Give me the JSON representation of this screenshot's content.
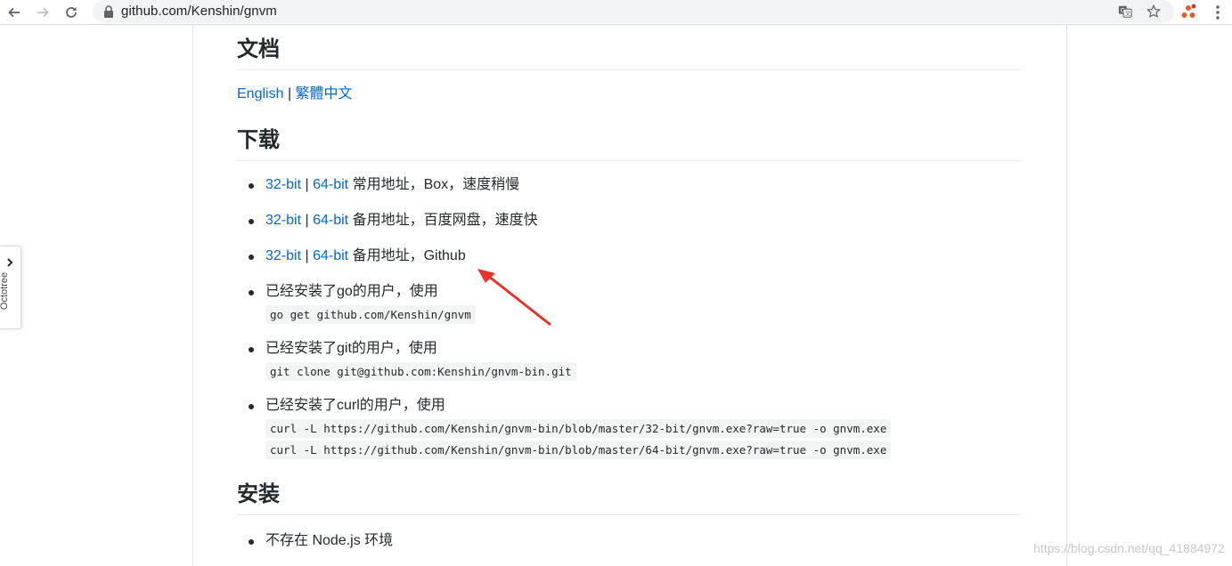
{
  "browser": {
    "url": "github.com/Kenshin/gnvm",
    "icons": [
      "back-icon",
      "forward-icon",
      "reload-icon",
      "lock-icon",
      "translate-icon",
      "bookmark-star-icon",
      "extension-icon",
      "menu-icon"
    ]
  },
  "octotree": {
    "label": "Octotree"
  },
  "sections": {
    "docs": {
      "title": "文档",
      "english": "English",
      "sep": "|",
      "traditional": "繁體中文"
    },
    "download": {
      "title": "下载",
      "items": [
        {
          "l32": "32-bit",
          "sep": "|",
          "l64": "64-bit",
          "desc": "常用地址，Box，速度稍慢"
        },
        {
          "l32": "32-bit",
          "sep": "|",
          "l64": "64-bit",
          "desc": "备用地址，百度网盘，速度快"
        },
        {
          "l32": "32-bit",
          "sep": "|",
          "l64": "64-bit",
          "desc": "备用地址，Github"
        },
        {
          "text": "已经安装了go的用户，使用",
          "code": [
            "go get github.com/Kenshin/gnvm"
          ]
        },
        {
          "text": "已经安装了git的用户，使用",
          "code": [
            "git clone git@github.com:Kenshin/gnvm-bin.git"
          ]
        },
        {
          "text": "已经安装了curl的用户，使用",
          "code": [
            "curl -L https://github.com/Kenshin/gnvm-bin/blob/master/32-bit/gnvm.exe?raw=true -o gnvm.exe",
            "curl -L https://github.com/Kenshin/gnvm-bin/blob/master/64-bit/gnvm.exe?raw=true -o gnvm.exe"
          ]
        }
      ]
    },
    "install": {
      "title": "安装",
      "items": [
        "不存在 Node.js 环境"
      ]
    }
  },
  "annotation": {
    "color": "#e8332a"
  },
  "watermark": "https://blog.csdn.net/qq_41884972",
  "colors": {
    "link": "#0366d6",
    "text": "#24292e"
  }
}
